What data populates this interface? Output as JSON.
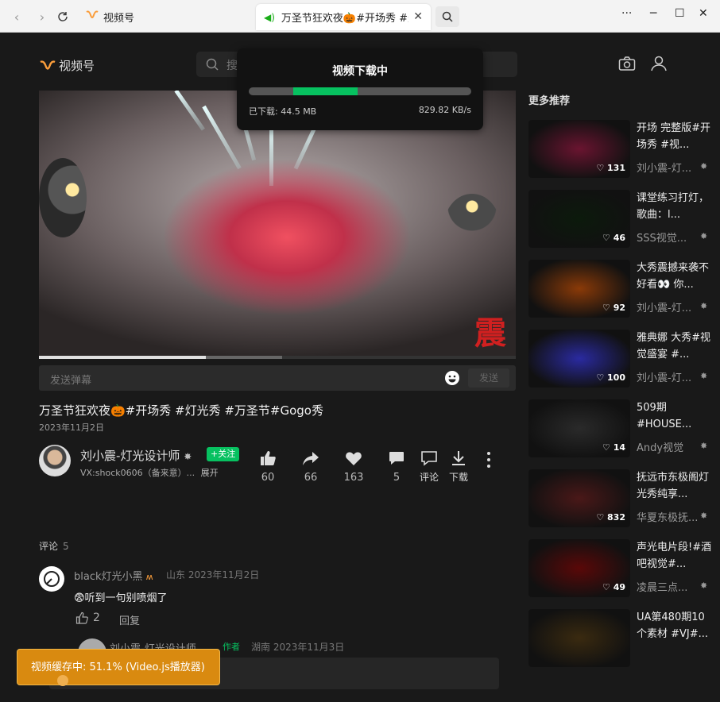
{
  "browser": {
    "site_title": "视频号",
    "tab_title": "万圣节狂欢夜🎃#开场秀 #灯光",
    "tab_close": "✕",
    "menu": "···",
    "minimize": "─",
    "maximize": "☐",
    "close": "✕"
  },
  "header": {
    "logo_text": "视频号",
    "search_placeholder": "搜索"
  },
  "download": {
    "title": "视频下载中",
    "downloaded": "已下载: 44.5 MB",
    "speed": "829.82 KB/s",
    "progress": 0.29
  },
  "player": {
    "progress": 0.35,
    "buffered": 0.51,
    "watermark": "震"
  },
  "danmaku": {
    "placeholder": "发送弹幕",
    "send": "发送"
  },
  "video": {
    "title": "万圣节狂欢夜🎃#开场秀 #灯光秀 #万圣节#Gogo秀",
    "date": "2023年11月2日"
  },
  "author": {
    "name": "刘小震-灯光设计师",
    "follow": "+关注",
    "desc": "VX:shock0606（备来意）...",
    "expand": "展开"
  },
  "actions": {
    "like": "60",
    "share": "66",
    "heart": "163",
    "comment": "5",
    "comment_label": "评论",
    "download_label": "下载"
  },
  "comments": {
    "header": "评论",
    "count": "5",
    "first": {
      "name": "black灯光小黑",
      "meta": "山东 2023年11月2日",
      "text": "😨听到一句别喷烟了",
      "likes": "2",
      "reply": "回复"
    },
    "reply": {
      "name": "刘小震-灯光设计师",
      "tag": "作者",
      "meta": "湖南 2023年11月3日"
    }
  },
  "toast": {
    "text": "视频缓存中: 51.1% (Video.js播放器)"
  },
  "recommend": {
    "header": "更多推荐",
    "items": [
      {
        "title": "开场 完整版#开场秀 #视...",
        "views": "131",
        "author": "刘小震-灯...",
        "color": "#6a1430"
      },
      {
        "title": "课堂练习打灯，歌曲：l...",
        "views": "46",
        "author": "SSS视觉...",
        "color": "#0c1a0c"
      },
      {
        "title": "大秀震撼来袭不好看👀 你...",
        "views": "92",
        "author": "刘小震-灯...",
        "color": "#8a3a08"
      },
      {
        "title": "雅典娜 大秀#视觉盛宴 #...",
        "views": "100",
        "author": "刘小震-灯...",
        "color": "#2a2aa0"
      },
      {
        "title": "509期 #HOUSE...",
        "views": "14",
        "author": "Andy视觉",
        "color": "#2a2a2a"
      },
      {
        "title": "抚远市东极阁灯光秀纯享...",
        "views": "832",
        "author": "华夏东极抚...",
        "color": "#4a1818"
      },
      {
        "title": "声光电片段!#酒吧视觉#...",
        "views": "49",
        "author": "凌晨三点...",
        "color": "#5a0808"
      },
      {
        "title": "UA第480期10个素材 #VJ#...",
        "views": "",
        "author": "",
        "color": "#3a2a10"
      }
    ]
  },
  "colors": {
    "accent_green": "#07c160",
    "brand_orange": "#fa9d3b",
    "toast_orange": "#d98a10"
  }
}
